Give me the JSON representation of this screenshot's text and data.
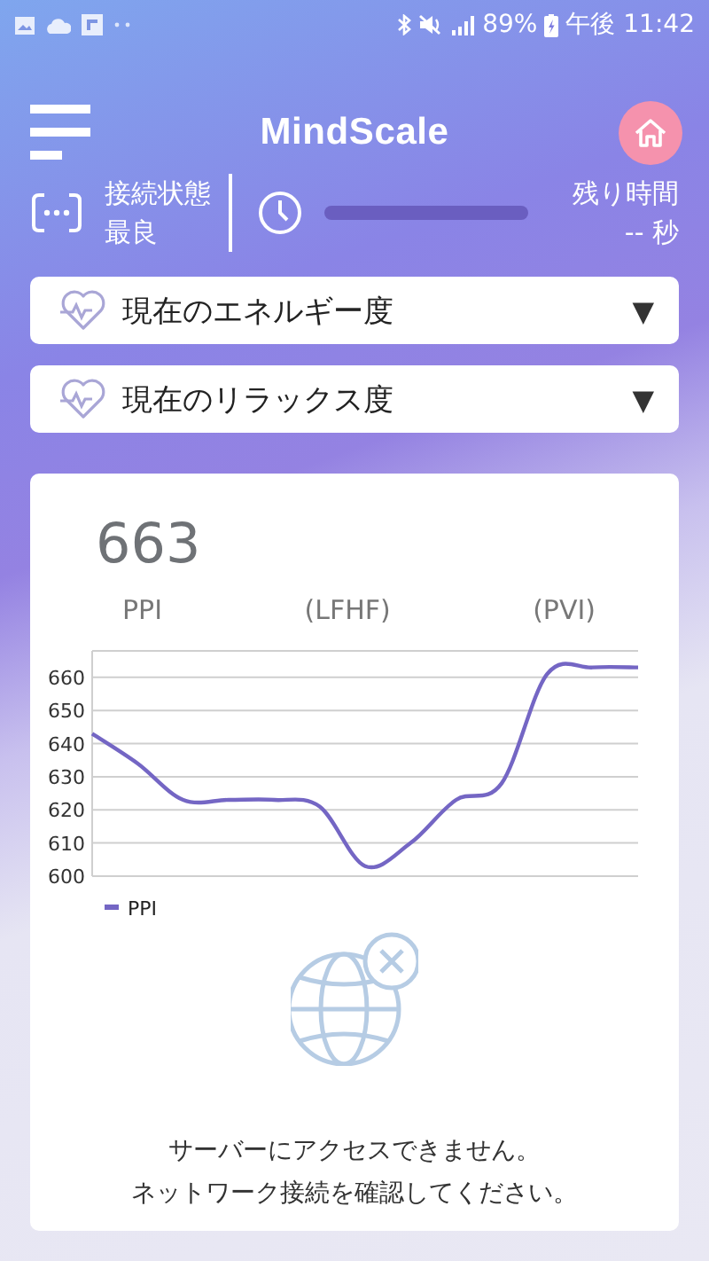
{
  "status_bar": {
    "battery": "89%",
    "time": "午後 11:42"
  },
  "header": {
    "title": "MindScale"
  },
  "connection": {
    "label": "接続状態",
    "value": "最良"
  },
  "timer": {
    "label": "残り時間",
    "value": "-- 秒"
  },
  "dropdowns": [
    {
      "label": "現在のエネルギー度",
      "caret": "▼"
    },
    {
      "label": "現在のリラックス度",
      "caret": "▼"
    }
  ],
  "reading": {
    "value": "663",
    "labels": [
      "PPI",
      "(LFHF)",
      "(PVI)"
    ]
  },
  "chart": {
    "chart_data": {
      "type": "line",
      "grid": true,
      "ylim": [
        600,
        668
      ],
      "yticks": [
        600,
        610,
        620,
        630,
        640,
        650,
        660
      ],
      "series": [
        {
          "name": "PPI",
          "color": "#7466c4",
          "values": [
            643,
            634,
            623,
            623,
            623,
            621,
            603,
            610,
            623,
            628,
            661,
            663,
            663
          ]
        }
      ]
    }
  },
  "error": {
    "lines": [
      "サーバーにアクセスできません。",
      "ネットワーク接続を確認してください。"
    ]
  }
}
